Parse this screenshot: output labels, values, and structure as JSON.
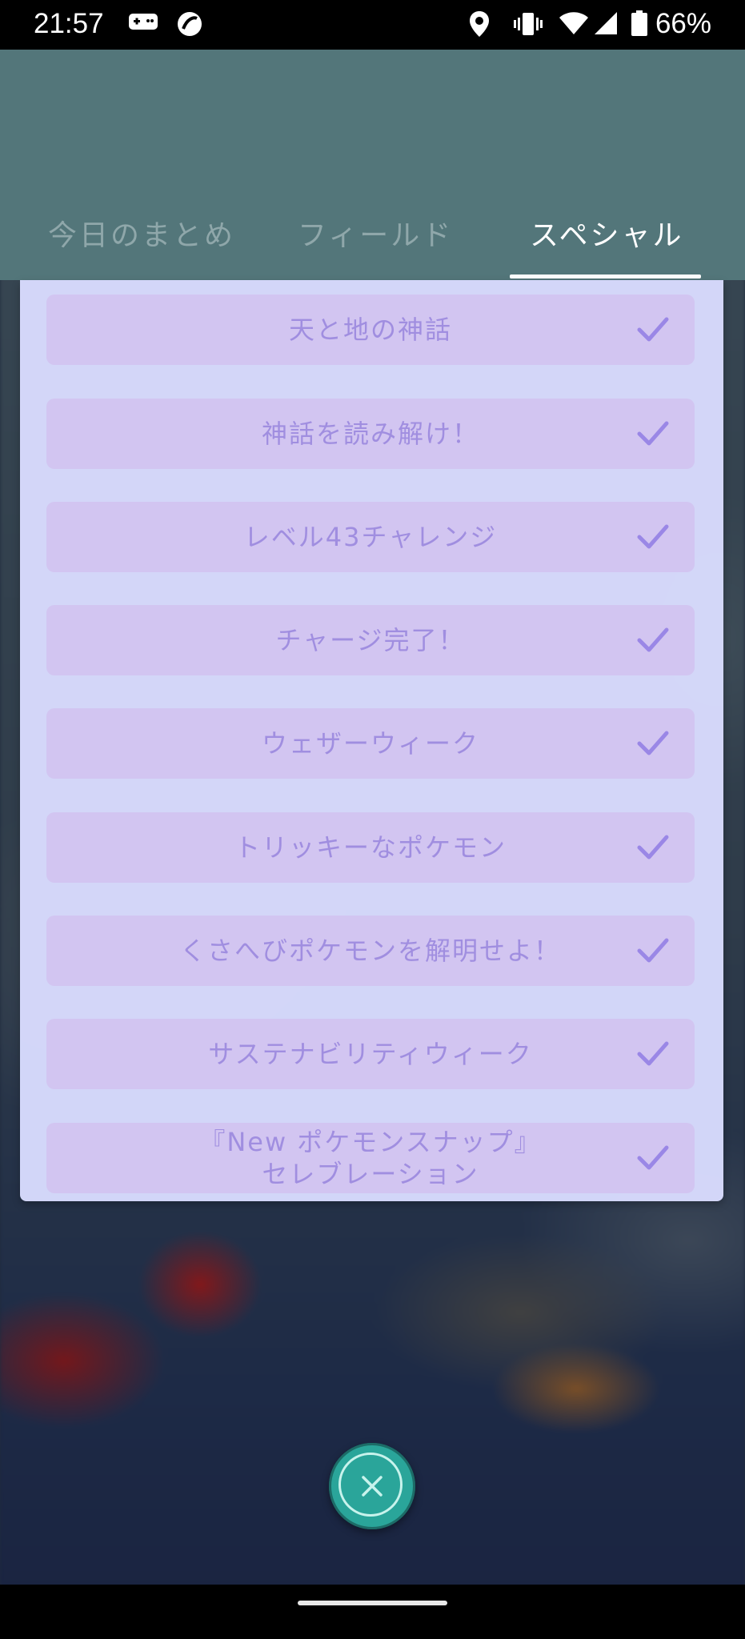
{
  "status_bar": {
    "time": "21:57",
    "battery": "66%",
    "icons": [
      "gamepad-icon",
      "app-icon",
      "location-icon",
      "vibrate-icon",
      "wifi-icon",
      "signal-icon",
      "battery-icon"
    ]
  },
  "tabs": [
    {
      "label": "今日のまとめ",
      "active": false
    },
    {
      "label": "フィールド",
      "active": false
    },
    {
      "label": "スペシャル",
      "active": true
    }
  ],
  "research_items": [
    {
      "label": "天と地の神話",
      "completed": true
    },
    {
      "label": "神話を読み解け！",
      "completed": true
    },
    {
      "label": "レベル43チャレンジ",
      "completed": true
    },
    {
      "label": "チャージ完了！",
      "completed": true
    },
    {
      "label": "ウェザーウィーク",
      "completed": true
    },
    {
      "label": "トリッキーなポケモン",
      "completed": true
    },
    {
      "label": "くさへびポケモンを解明せよ！",
      "completed": true
    },
    {
      "label": "サステナビリティウィーク",
      "completed": true
    },
    {
      "label": "『New ポケモンスナップ』\nセレブレーション",
      "completed": true
    }
  ],
  "colors": {
    "header": "#53767a",
    "item_bg": "#d2c5f1",
    "item_text": "#a08ee0",
    "close_button": "#2aa59a"
  }
}
